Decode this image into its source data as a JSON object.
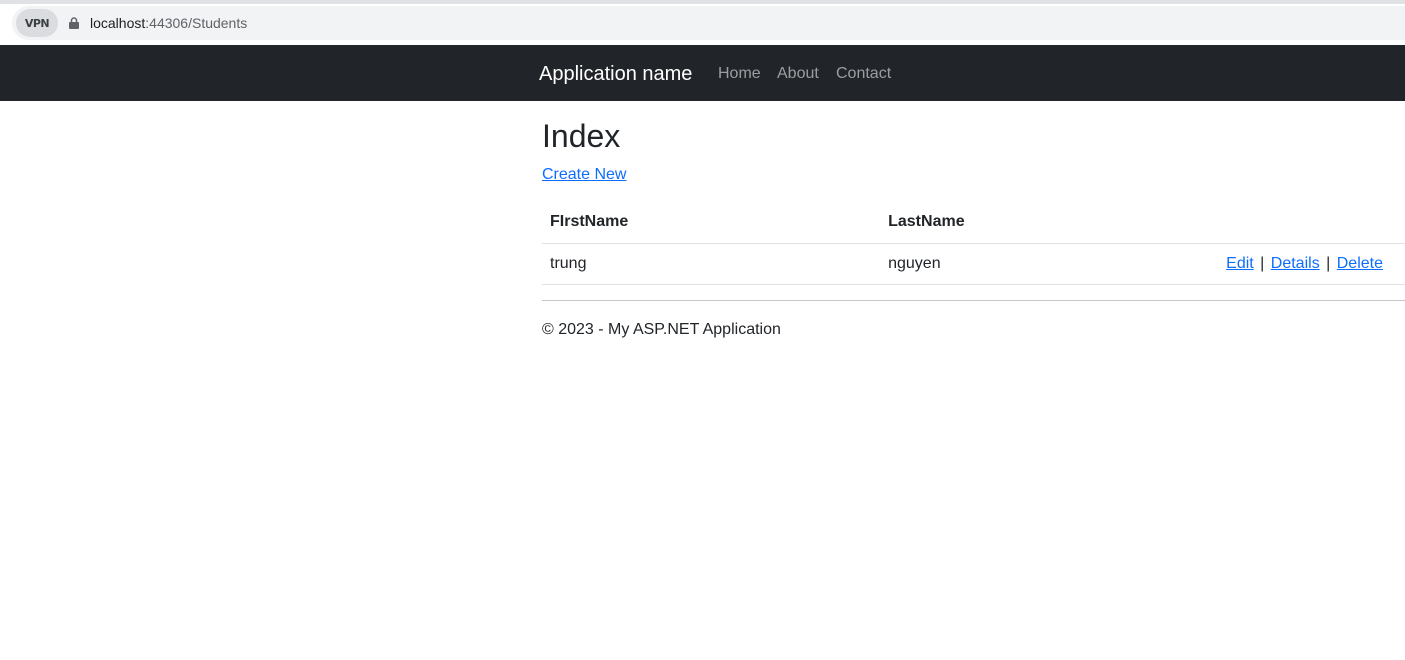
{
  "browser": {
    "vpn_label": "VPN",
    "url_host": "localhost",
    "url_rest": ":44306/Students"
  },
  "navbar": {
    "brand": "Application name",
    "links": [
      "Home",
      "About",
      "Contact"
    ]
  },
  "main": {
    "title": "Index",
    "create_link": "Create New",
    "table": {
      "headers": [
        "FIrstName",
        "LastName"
      ],
      "rows": [
        {
          "first_name": "trung",
          "last_name": "nguyen",
          "actions": [
            "Edit",
            "Details",
            "Delete"
          ]
        }
      ],
      "separator": "|"
    }
  },
  "footer": {
    "text": "© 2023 - My ASP.NET Application"
  },
  "colors": {
    "navbar_bg": "#212529",
    "link": "#0d6efd"
  }
}
